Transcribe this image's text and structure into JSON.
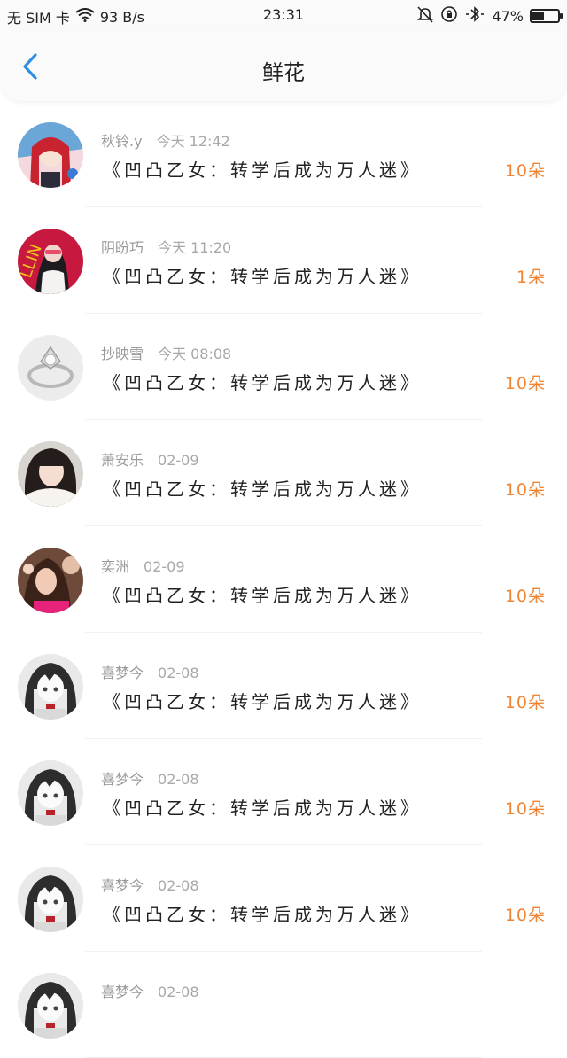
{
  "status_bar": {
    "carrier": "无 SIM 卡",
    "speed": "93 B/s",
    "time": "23:31",
    "battery": "47%",
    "battery_level": 0.47
  },
  "nav": {
    "title": "鲜花"
  },
  "items": [
    {
      "user": "秋铃.y",
      "time": "今天 12:42",
      "book": "《凹凸乙女：转学后成为万人迷》",
      "count": "10朵",
      "avatar": "avatar-girl-red"
    },
    {
      "user": "阴盼巧",
      "time": "今天 11:20",
      "book": "《凹凸乙女：转学后成为万人迷》",
      "count": "1朵",
      "avatar": "avatar-girl-pink"
    },
    {
      "user": "抄映雪",
      "time": "今天 08:08",
      "book": "《凹凸乙女：转学后成为万人迷》",
      "count": "10朵",
      "avatar": "avatar-ring"
    },
    {
      "user": "萧安乐",
      "time": "02-09",
      "book": "《凹凸乙女：转学后成为万人迷》",
      "count": "10朵",
      "avatar": "avatar-girl-white"
    },
    {
      "user": "奕洲",
      "time": "02-09",
      "book": "《凹凸乙女：转学后成为万人迷》",
      "count": "10朵",
      "avatar": "avatar-girl-flowers"
    },
    {
      "user": "喜梦今",
      "time": "02-08",
      "book": "《凹凸乙女：转学后成为万人迷》",
      "count": "10朵",
      "avatar": "avatar-anime"
    },
    {
      "user": "喜梦今",
      "time": "02-08",
      "book": "《凹凸乙女：转学后成为万人迷》",
      "count": "10朵",
      "avatar": "avatar-anime"
    },
    {
      "user": "喜梦今",
      "time": "02-08",
      "book": "《凹凸乙女：转学后成为万人迷》",
      "count": "10朵",
      "avatar": "avatar-anime"
    },
    {
      "user": "喜梦今",
      "time": "02-08",
      "book": "",
      "count": "",
      "avatar": "avatar-anime"
    }
  ],
  "colors": {
    "accent": "#2f8fe5",
    "count": "#f08536",
    "muted": "#9a9a9a"
  }
}
